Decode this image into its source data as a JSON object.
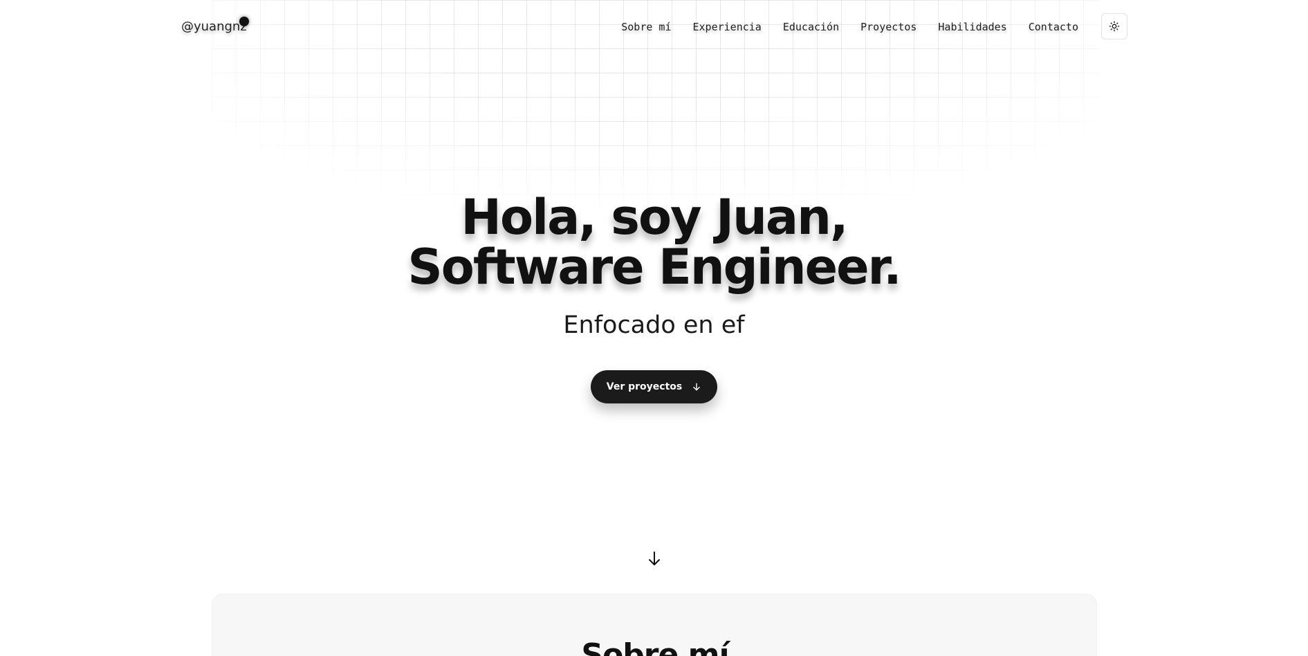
{
  "header": {
    "logo_text": "@yuangnz",
    "nav": [
      {
        "label": "Sobre mí"
      },
      {
        "label": "Experiencia"
      },
      {
        "label": "Educación"
      },
      {
        "label": "Proyectos"
      },
      {
        "label": "Habilidades"
      },
      {
        "label": "Contacto"
      }
    ],
    "theme_toggle_icon": "sun-icon"
  },
  "hero": {
    "title_line1": "Hola, soy Juan,",
    "title_line2": "Software Engineer.",
    "subtitle": "Enfocado en ef",
    "cta_label": "Ver proyectos",
    "cta_icon": "arrow-down-icon"
  },
  "scroll_indicator_icon": "arrow-down-icon",
  "about": {
    "title": "Sobre mí"
  },
  "colors": {
    "background": "#ffffff",
    "text": "#111111",
    "button_bg": "#1b1b1b",
    "card_bg": "#f7f7f7"
  }
}
